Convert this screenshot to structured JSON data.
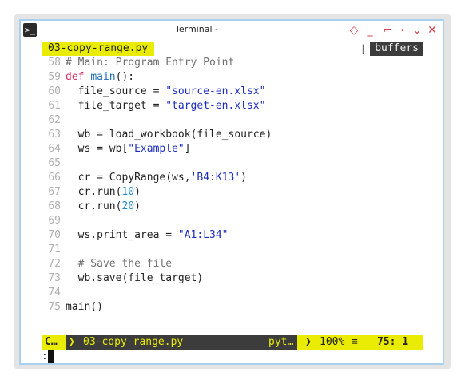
{
  "window": {
    "title": "Terminal -",
    "controls": [
      "diamond-icon",
      "minimize-icon",
      "maximize-icon",
      "dot-icon",
      "close-icon"
    ]
  },
  "tabline": {
    "active_tab": "03-copy-range.py",
    "buffers_label": "buffers"
  },
  "code_lines": [
    {
      "num": "58",
      "parts": [
        {
          "cls": "cmt",
          "t": "# Main: Program Entry Point"
        }
      ]
    },
    {
      "num": "59",
      "parts": [
        {
          "cls": "kw",
          "t": "def "
        },
        {
          "cls": "fn",
          "t": "main"
        },
        {
          "cls": "txt",
          "t": "():"
        }
      ]
    },
    {
      "num": "60",
      "parts": [
        {
          "cls": "txt",
          "t": "  file_source = "
        },
        {
          "cls": "str",
          "t": "\"source-en.xlsx\""
        }
      ]
    },
    {
      "num": "61",
      "parts": [
        {
          "cls": "txt",
          "t": "  file_target = "
        },
        {
          "cls": "str",
          "t": "\"target-en.xlsx\""
        }
      ]
    },
    {
      "num": "62",
      "parts": []
    },
    {
      "num": "63",
      "parts": [
        {
          "cls": "txt",
          "t": "  wb = load_workbook(file_source)"
        }
      ]
    },
    {
      "num": "64",
      "parts": [
        {
          "cls": "txt",
          "t": "  ws = wb["
        },
        {
          "cls": "str",
          "t": "\"Example\""
        },
        {
          "cls": "txt",
          "t": "]"
        }
      ]
    },
    {
      "num": "65",
      "parts": []
    },
    {
      "num": "66",
      "parts": [
        {
          "cls": "txt",
          "t": "  cr = CopyRange(ws,"
        },
        {
          "cls": "str",
          "t": "'B4:K13'"
        },
        {
          "cls": "txt",
          "t": ")"
        }
      ]
    },
    {
      "num": "67",
      "parts": [
        {
          "cls": "txt",
          "t": "  cr.run("
        },
        {
          "cls": "num",
          "t": "10"
        },
        {
          "cls": "txt",
          "t": ")"
        }
      ]
    },
    {
      "num": "68",
      "parts": [
        {
          "cls": "txt",
          "t": "  cr.run("
        },
        {
          "cls": "num",
          "t": "20"
        },
        {
          "cls": "txt",
          "t": ")"
        }
      ]
    },
    {
      "num": "69",
      "parts": []
    },
    {
      "num": "70",
      "parts": [
        {
          "cls": "txt",
          "t": "  ws.print_area = "
        },
        {
          "cls": "str",
          "t": "\"A1:L34\""
        }
      ]
    },
    {
      "num": "71",
      "parts": []
    },
    {
      "num": "72",
      "parts": [
        {
          "cls": "cmt",
          "t": "  # Save the file"
        }
      ]
    },
    {
      "num": "73",
      "parts": [
        {
          "cls": "txt",
          "t": "  wb.save(file_target)"
        }
      ]
    },
    {
      "num": "74",
      "parts": []
    },
    {
      "num": "75",
      "parts": [
        {
          "cls": "txt",
          "t": "main()"
        }
      ]
    }
  ],
  "statusline": {
    "mode": "C…",
    "filename": "03-copy-range.py",
    "filetype": "pyt…",
    "percent": "100%",
    "line_col": "75:  1"
  },
  "cmdline": {
    "text": ":"
  }
}
